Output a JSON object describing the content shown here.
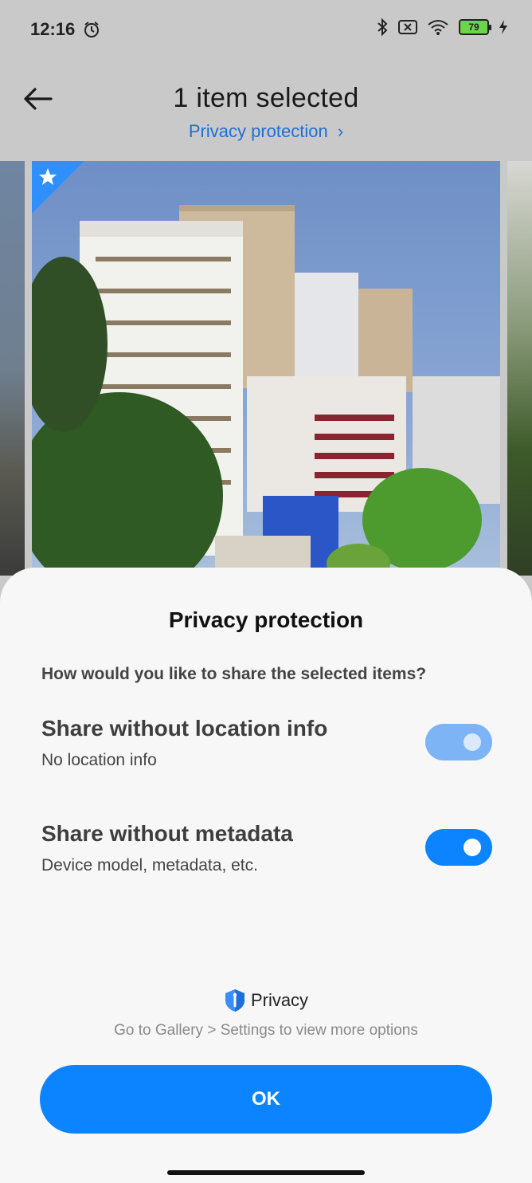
{
  "status_bar": {
    "time": "12:16",
    "battery": "79",
    "icons": [
      "alarm-icon",
      "bluetooth-icon",
      "sim-disabled-icon",
      "wifi-icon",
      "battery-icon",
      "charging-icon"
    ]
  },
  "header": {
    "title": "1 item selected",
    "privacy_link": "Privacy protection",
    "back_icon": "arrow-left-icon"
  },
  "sheet": {
    "title": "Privacy protection",
    "question": "How would you like to share the selected items?",
    "options": [
      {
        "title": "Share without location info",
        "subtitle": "No location info",
        "enabled": false
      },
      {
        "title": "Share without metadata",
        "subtitle": "Device model, metadata, etc.",
        "enabled": true
      }
    ],
    "brand": "Privacy",
    "hint": "Go to Gallery > Settings to view more options",
    "ok_label": "OK"
  },
  "colors": {
    "accent": "#0d84ff",
    "link": "#1e6fd6",
    "background_dim": "#c9c9c9",
    "sheet": "#f7f7f7"
  }
}
